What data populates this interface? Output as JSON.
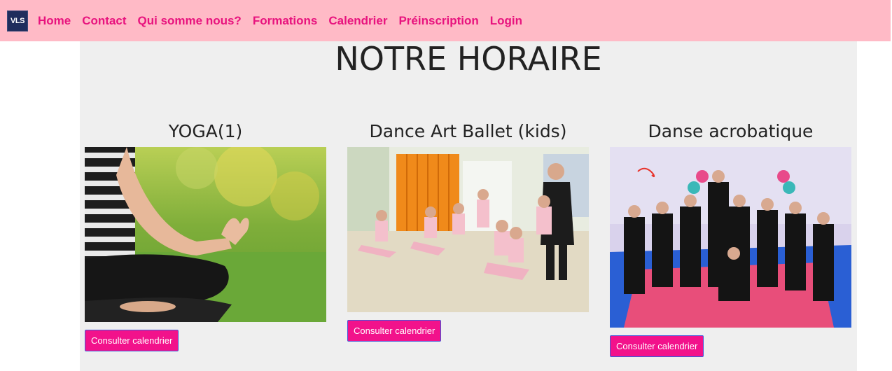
{
  "brand": {
    "logo_text": "VLS"
  },
  "nav": {
    "items": [
      {
        "label": "Home"
      },
      {
        "label": "Contact"
      },
      {
        "label": "Qui somme nous?"
      },
      {
        "label": "Formations"
      },
      {
        "label": "Calendrier"
      },
      {
        "label": "Préinscription"
      },
      {
        "label": "Login"
      }
    ]
  },
  "page": {
    "title": "NOTRE HORAIRE"
  },
  "courses": [
    {
      "title": "YOGA(1)",
      "button": "Consulter calendrier"
    },
    {
      "title": "Dance Art Ballet (kids)",
      "button": "Consulter calendrier"
    },
    {
      "title": "Danse acrobatique",
      "button": "Consulter calendrier"
    }
  ],
  "colors": {
    "navbar_bg": "#ffbac6",
    "nav_link": "#e8137e",
    "button_bg": "#f2128b",
    "content_bg": "#efefef"
  }
}
